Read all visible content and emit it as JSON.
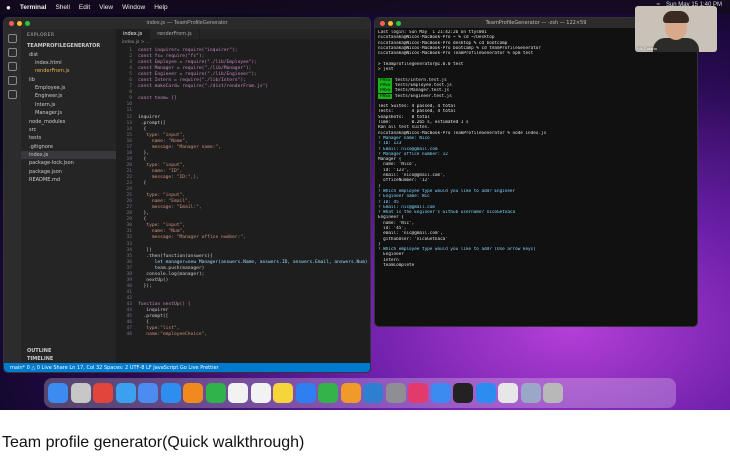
{
  "menubar": {
    "app": "Terminal",
    "items": [
      "Shell",
      "Edit",
      "View",
      "Window",
      "Help"
    ],
    "clock": "Sun May 15 1:40 PM"
  },
  "vscode": {
    "title": "index.js — TeamProfileGenerator",
    "explorer_header": "EXPLORER",
    "root": "TEAMPROFILEGENERATOR",
    "tree": [
      {
        "label": "dist",
        "selected": false
      },
      {
        "label": "index.html",
        "selected": false
      },
      {
        "label": "renderFrom.js",
        "selected": false
      },
      {
        "label": "lib",
        "selected": false
      },
      {
        "label": "Employee.js",
        "selected": false
      },
      {
        "label": "Engineer.js",
        "selected": false
      },
      {
        "label": "Intern.js",
        "selected": false
      },
      {
        "label": "Manager.js",
        "selected": false
      },
      {
        "label": "node_modules",
        "selected": false
      },
      {
        "label": "src",
        "selected": false
      },
      {
        "label": "tests",
        "selected": false
      },
      {
        "label": ".gitignore",
        "selected": false
      },
      {
        "label": "index.js",
        "selected": true
      },
      {
        "label": "package-lock.json",
        "selected": false
      },
      {
        "label": "package.json",
        "selected": false
      },
      {
        "label": "README.md",
        "selected": false
      }
    ],
    "outline_label": "OUTLINE",
    "timeline_label": "TIMELINE",
    "tabs": [
      "index.js",
      "renderFrom.js"
    ],
    "breadcrumb": "index.js > ...",
    "code": [
      "const inquirer= require(\"inquirer\");",
      "const fs= require(\"fs\");",
      "const Employee = require(\"./lib/Employee\");",
      "const Manager = require(\"./lib/Manager\");",
      "const Engineer = require(\"./lib/Engineer\");",
      "const Intern = require(\"./lib/Intern\");",
      "const makeCard= require(\"./dist/renderFrom.js\")",
      "",
      "const team= []",
      "",
      "",
      "inquirer",
      " .prompt([",
      "  {",
      "   type: \"input\",",
      "     name: \"Name\",",
      "     message: \"Manager name:\",",
      "  },",
      "  {",
      "   type: \"input\",",
      "     name: \"ID\",",
      "     message: \"ID:\",},",
      "  {",
      "",
      "   type: \"input\",",
      "     name: \"Email\",",
      "     message: \"Email:\",",
      "  },",
      "  {",
      "   type: \"input\",",
      "     name: \"Num\",",
      "     message: \"Manager office number:\",",
      "",
      "   ])",
      "   .then(function(answers){",
      "      let manager=new Manager(answers.Name, answers.ID, answers.Email, answers.Num)",
      "      team.push(manager)",
      "   console.log(manager);",
      "   nextUp()",
      "  });",
      "",
      "",
      "function nextUp() {",
      "   inquirer",
      "  .prompt([",
      "   {",
      "   type:\"list\",",
      "   name:\"employeeChoice\","
    ],
    "statusbar": "main*   0 △ 0   Live Share   Ln 17, Col 32   Spaces: 2   UTF-8   LF   JavaScript   Go Live   Prettier"
  },
  "terminal": {
    "title": "TeamProfileGenerator — -zsh — 122×59",
    "lines": [
      "Last login: Sun May  1 21:42:26 on ttys001",
      "nicotanaka@Nicos-MacBook-Pro ~ % cd ~/Desktop",
      "nicotanaka@Nicos-MacBook-Pro desktop % cd bootcamp",
      "nicotanaka@Nicos-MacBook-Pro bootcamp % cd teamProfileGenerator",
      "nicotanaka@Nicos-MacBook-Pro TeamProfileGenerator % npm test",
      "",
      "> teamprofilegenerator@1.0.0 test",
      "> jest",
      "",
      "PASS tests/Intern.test.js",
      "PASS tests/Employee.test.js",
      "PASS tests/Manager.test.js",
      "PASS tests/Engineer.test.js",
      "",
      "Test Suites: 4 passed, 4 total",
      "Tests:       4 passed, 4 total",
      "Snapshots:   0 total",
      "Time:        0.265 s, estimated 1 s",
      "Ran all test suites.",
      "nicotanaka@Nicos-MacBook-Pro TeamProfileGenerator % node index.js",
      "? Manager name: Nico",
      "? ID: 123",
      "? Email: nico@gmail.com",
      "? Manager office number: 12",
      "Manager {",
      "  name: 'Nico',",
      "  id: '123',",
      "  email: 'nico@gmail.com',",
      "  officeNumber: '12'",
      "}",
      "? Which employee type would you like to add? Engineer",
      "? Engineer name: Nic",
      "? ID: 45",
      "? Email: nic@gmail.com",
      "? What is the Engineer's Github username? nicoGetnaca",
      "Engineer {",
      "  name: 'Nic',",
      "  id: '45',",
      "  email: 'nic@gmail.com',",
      "  githubUser: 'nicoGetnaca'",
      "}",
      "? Which employee type would you like to add? (Use arrow keys)",
      "  Engineer",
      "  Intern",
      "  teamComplete"
    ]
  },
  "webcam": {
    "name_label": "Nic Catano"
  },
  "dock": {
    "apps": [
      "finder-icon",
      "launchpad-icon",
      "chrome-icon",
      "safari-icon",
      "mail-icon",
      "appstore-icon",
      "firefox-icon",
      "facetime-icon",
      "calendar-icon",
      "reminders-icon",
      "notes-icon",
      "keynote-icon",
      "numbers-icon",
      "pages-icon",
      "vscode-icon",
      "settings-icon",
      "slack-icon",
      "finder2-icon",
      "terminal-icon",
      "zoom-icon",
      "preview-icon",
      "downloads-icon",
      "trash-icon"
    ],
    "colors": [
      "#3b8bf0",
      "#c7c7c7",
      "#e2463a",
      "#3ca0f0",
      "#4a8cf0",
      "#2d8ef0",
      "#f08a1f",
      "#2fb34a",
      "#f2f2f2",
      "#f2f2f2",
      "#f5d53a",
      "#2f7ff0",
      "#34b34a",
      "#f09a2a",
      "#2f7fd0",
      "#8e8e93",
      "#e23a6a",
      "#3b8bf0",
      "#222222",
      "#2d8cf0",
      "#e7e7e7",
      "#9aa7c8",
      "#b8b8b8"
    ]
  },
  "caption": "Team profile generator(Quick walkthrough)"
}
